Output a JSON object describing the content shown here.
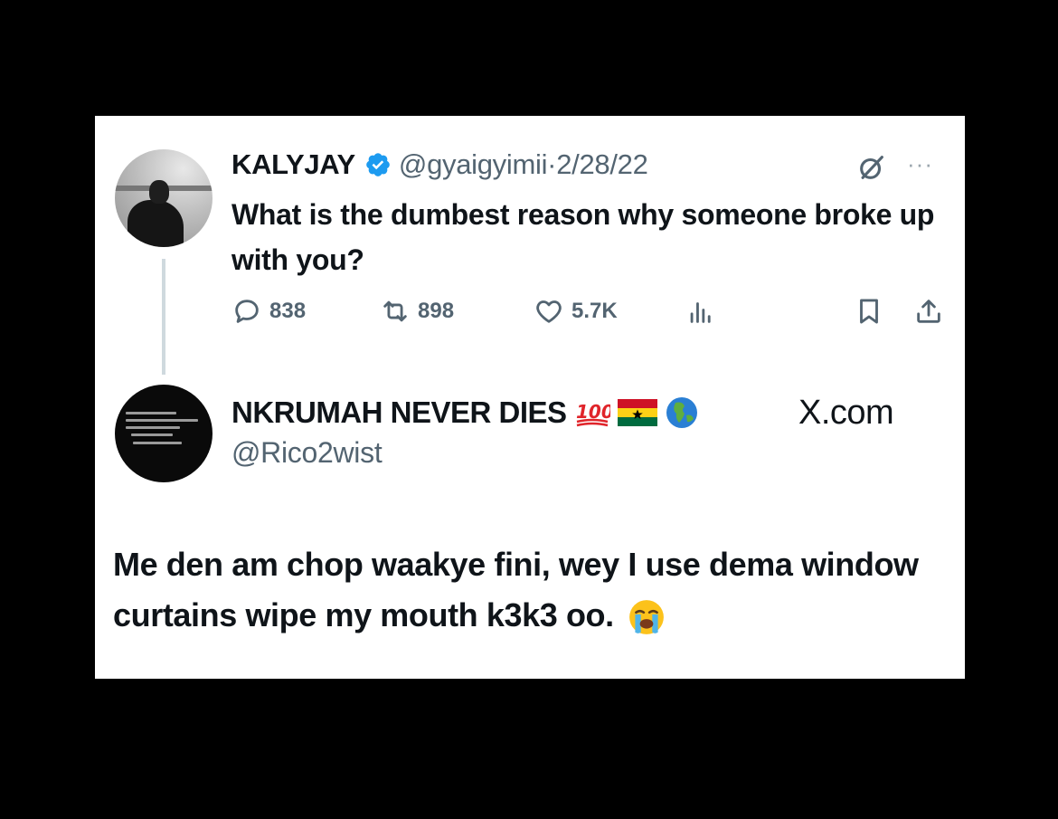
{
  "original_tweet": {
    "display_name": "KALYJAY",
    "handle": "@gyaigyimii",
    "separator": "·",
    "date": "2/28/22",
    "text": "What is the dumbest reason why  someone broke up with you?",
    "stats": {
      "replies": "838",
      "reposts": "898",
      "likes": "5.7K"
    },
    "icons": [
      "verified-badge-icon",
      "grok-icon",
      "more-icon",
      "reply-icon",
      "repost-icon",
      "like-icon",
      "views-icon",
      "bookmark-icon",
      "share-icon"
    ]
  },
  "reply": {
    "display_name": "NKRUMAH NEVER DIES",
    "name_emojis": [
      "💯",
      "🇬🇭",
      "🌍"
    ],
    "handle": "@Rico2wist",
    "watermark": "X.com",
    "text": "Me den am chop waakye fini, wey I use dema window curtains wipe my mouth k3k3 oo.",
    "trailing_emoji": "😭"
  },
  "colors": {
    "background": "#000000",
    "card": "#ffffff",
    "text_primary": "#0f1419",
    "text_secondary": "#536471",
    "verified_blue": "#1d9bf0",
    "thread_line": "#cfd9de"
  }
}
